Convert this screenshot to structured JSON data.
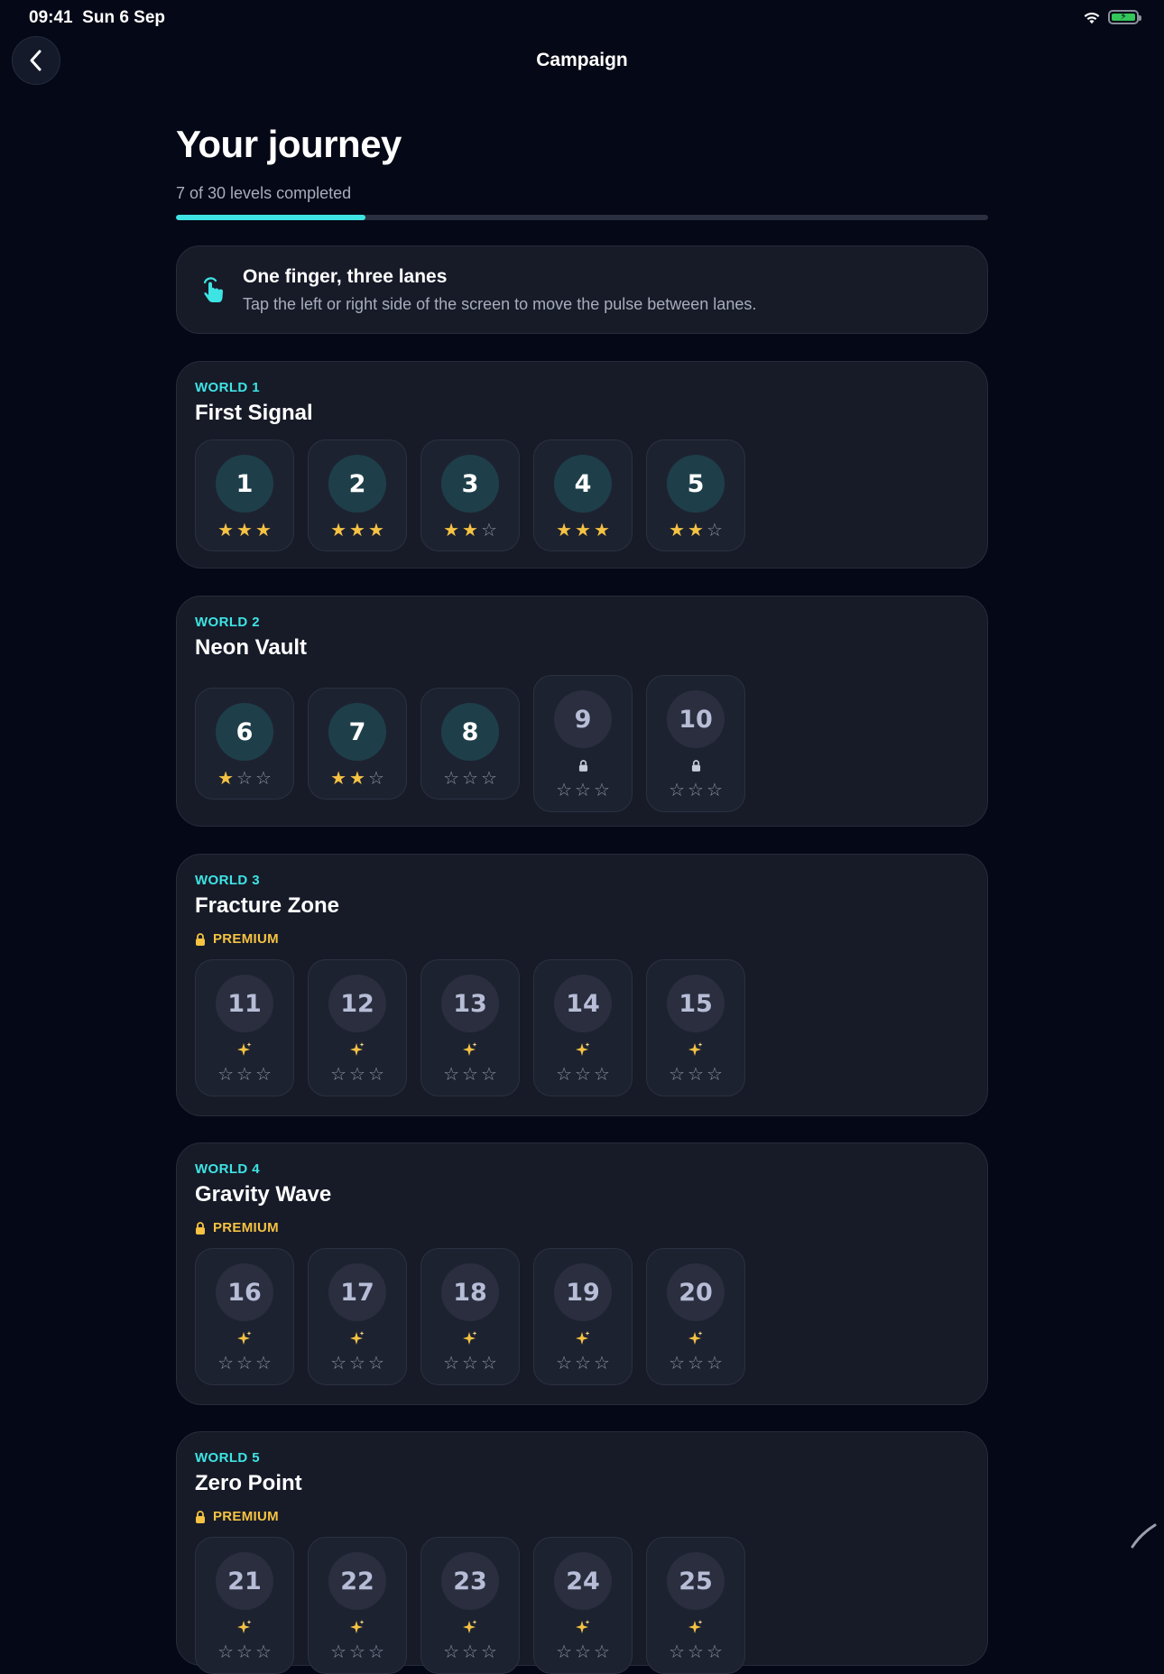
{
  "status": {
    "time": "09:41",
    "date": "Sun 6 Sep"
  },
  "nav": {
    "title": "Campaign"
  },
  "header": {
    "title": "Your journey",
    "progress_text": "7 of 30 levels completed",
    "progress_fraction": 0.233
  },
  "tip": {
    "title": "One finger, three lanes",
    "description": "Tap the left or right side of the screen to move the pulse between lanes."
  },
  "worlds": [
    {
      "label": "WORLD 1",
      "name": "First Signal",
      "premium": "",
      "levels": [
        {
          "num": "1",
          "stars": 3,
          "state": "open"
        },
        {
          "num": "2",
          "stars": 3,
          "state": "open"
        },
        {
          "num": "3",
          "stars": 2,
          "state": "open"
        },
        {
          "num": "4",
          "stars": 3,
          "state": "open"
        },
        {
          "num": "5",
          "stars": 2,
          "state": "open"
        }
      ]
    },
    {
      "label": "WORLD 2",
      "name": "Neon Vault",
      "premium": "",
      "levels": [
        {
          "num": "6",
          "stars": 1,
          "state": "open"
        },
        {
          "num": "7",
          "stars": 2,
          "state": "open"
        },
        {
          "num": "8",
          "stars": 0,
          "state": "open"
        },
        {
          "num": "9",
          "stars": 0,
          "state": "locked"
        },
        {
          "num": "10",
          "stars": 0,
          "state": "locked"
        }
      ]
    },
    {
      "label": "WORLD 3",
      "name": "Fracture Zone",
      "premium": "PREMIUM",
      "levels": [
        {
          "num": "11",
          "stars": 0,
          "state": "premium"
        },
        {
          "num": "12",
          "stars": 0,
          "state": "premium"
        },
        {
          "num": "13",
          "stars": 0,
          "state": "premium"
        },
        {
          "num": "14",
          "stars": 0,
          "state": "premium"
        },
        {
          "num": "15",
          "stars": 0,
          "state": "premium"
        }
      ]
    },
    {
      "label": "WORLD 4",
      "name": "Gravity Wave",
      "premium": "PREMIUM",
      "levels": [
        {
          "num": "16",
          "stars": 0,
          "state": "premium"
        },
        {
          "num": "17",
          "stars": 0,
          "state": "premium"
        },
        {
          "num": "18",
          "stars": 0,
          "state": "premium"
        },
        {
          "num": "19",
          "stars": 0,
          "state": "premium"
        },
        {
          "num": "20",
          "stars": 0,
          "state": "premium"
        }
      ]
    },
    {
      "label": "WORLD 5",
      "name": "Zero Point",
      "premium": "PREMIUM",
      "levels": [
        {
          "num": "21",
          "stars": 0,
          "state": "premium"
        },
        {
          "num": "22",
          "stars": 0,
          "state": "premium"
        },
        {
          "num": "23",
          "stars": 0,
          "state": "premium"
        },
        {
          "num": "24",
          "stars": 0,
          "state": "premium"
        },
        {
          "num": "25",
          "stars": 0,
          "state": "premium"
        }
      ]
    }
  ],
  "colors": {
    "background": "#050816",
    "accent": "#3ee4e4",
    "star_on": "#f5c242",
    "star_off": "#8b90a2",
    "premium": "#f5c242",
    "card": "#171b28"
  },
  "icons": {
    "back": "chevron-left-icon",
    "tip": "tap-finger-icon",
    "lock": "lock-icon",
    "sparkle": "sparkle-icon",
    "star": "star-icon",
    "wifi": "wifi-icon",
    "battery": "battery-charging-icon"
  }
}
